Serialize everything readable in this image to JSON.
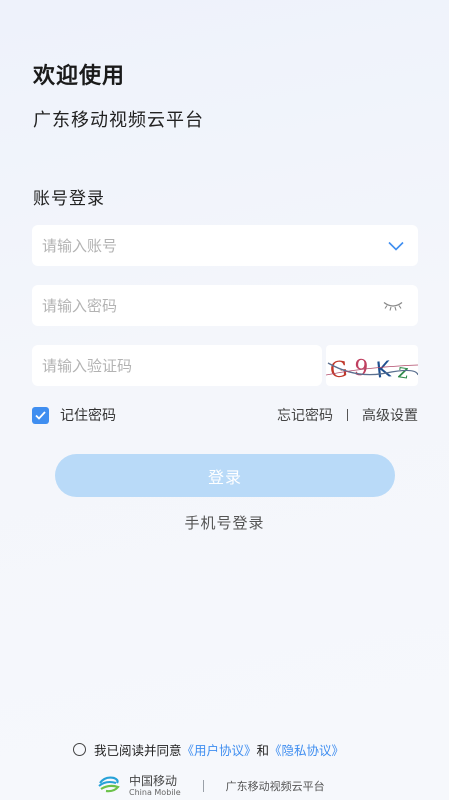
{
  "header": {
    "welcome": "欢迎使用",
    "platform_name": "广东移动视频云平台"
  },
  "login": {
    "section_title": "账号登录",
    "account_placeholder": "请输入账号",
    "password_placeholder": "请输入密码",
    "captcha_placeholder": "请输入验证码",
    "captcha_image_text": "G9Kz",
    "remember_label": "记住密码",
    "remember_checked": true,
    "forgot_label": "忘记密码",
    "advanced_label": "高级设置",
    "login_button": "登录",
    "phone_login": "手机号登录"
  },
  "agreement": {
    "prefix": "我已阅读并同意",
    "user_agreement": "《用户协议》",
    "conjunction": "和",
    "privacy_agreement": "《隐私协议》"
  },
  "footer": {
    "brand_cn": "中国移动",
    "brand_en": "China Mobile",
    "platform_name": "广东移动视频云平台"
  },
  "colors": {
    "accent": "#3f8ef0",
    "button_disabled": "#b9daf8"
  },
  "icons": [
    "chevron-down-icon",
    "eye-closed-icon",
    "checkmark-icon",
    "china-mobile-logo"
  ]
}
